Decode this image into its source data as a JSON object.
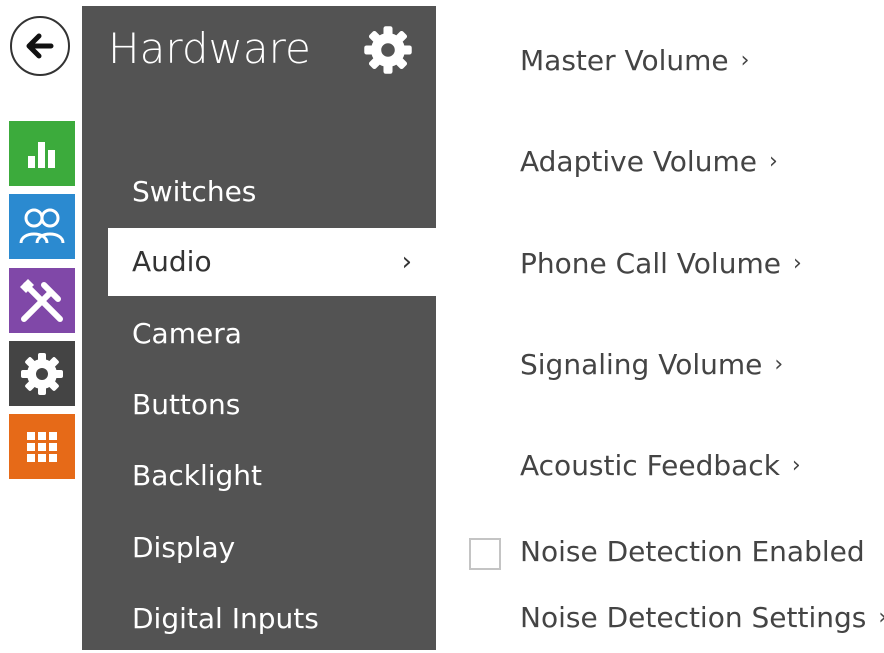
{
  "panel": {
    "title": "Hardware"
  },
  "menu": {
    "items": [
      {
        "label": "Switches"
      },
      {
        "label": "Audio",
        "chevron": "›"
      },
      {
        "label": "Camera"
      },
      {
        "label": "Buttons"
      },
      {
        "label": "Backlight"
      },
      {
        "label": "Display"
      },
      {
        "label": "Digital Inputs"
      }
    ]
  },
  "content": {
    "links": [
      {
        "label": "Master Volume"
      },
      {
        "label": "Adaptive Volume"
      },
      {
        "label": "Phone Call Volume"
      },
      {
        "label": "Signaling Volume"
      },
      {
        "label": "Acoustic Feedback"
      }
    ],
    "noise_detection_enabled": {
      "label": "Noise Detection Enabled",
      "checked": false
    },
    "noise_detection_settings": {
      "label": "Noise Detection Settings"
    },
    "arrow": "›"
  },
  "rail": {
    "icons": [
      "back-arrow-icon",
      "chart-icon",
      "users-icon",
      "tools-icon",
      "gear-icon",
      "grid-icon"
    ],
    "colors": {
      "green": "#3cab3c",
      "blue": "#2b8ad0",
      "purple": "#8048a8",
      "gray": "#444444",
      "orange": "#e66a18"
    }
  }
}
